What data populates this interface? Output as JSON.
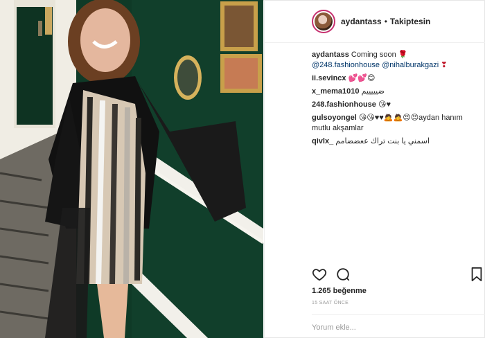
{
  "post": {
    "username": "aydantass",
    "separator": "•",
    "follow_status": "Takiptesin"
  },
  "comments": [
    {
      "user": "aydantass",
      "text": "Coming soon",
      "emoji": "🌹",
      "mentions": [
        "@248.fashionhouse",
        "@nihalburakgazi"
      ],
      "trailing": "❣"
    },
    {
      "user": "ii.sevincx",
      "text": "💕💕😊"
    },
    {
      "user": "x_mema1010",
      "text": "ضيييييم"
    },
    {
      "user": "248.fashionhouse",
      "text": "😘♥"
    },
    {
      "user": "gulsoyongel",
      "text": "😘😘♥♥🙇🙇😍😍aydan hanım mutlu akşamlar"
    },
    {
      "user": "qivlx_",
      "text": "اسمني يا بنت تراك ععضضامم"
    }
  ],
  "actions": {
    "like_icon": "heart-icon",
    "comment_icon": "comment-icon",
    "save_icon": "bookmark-icon"
  },
  "likes_text": "1.265 beğenme",
  "time_text": "15 SAAT ÖNCE",
  "comment_placeholder": "Yorum ekle...",
  "colors": {
    "wall_green": "#0f3a27",
    "mention": "#003569",
    "avatar_ring": "#c6306f"
  }
}
